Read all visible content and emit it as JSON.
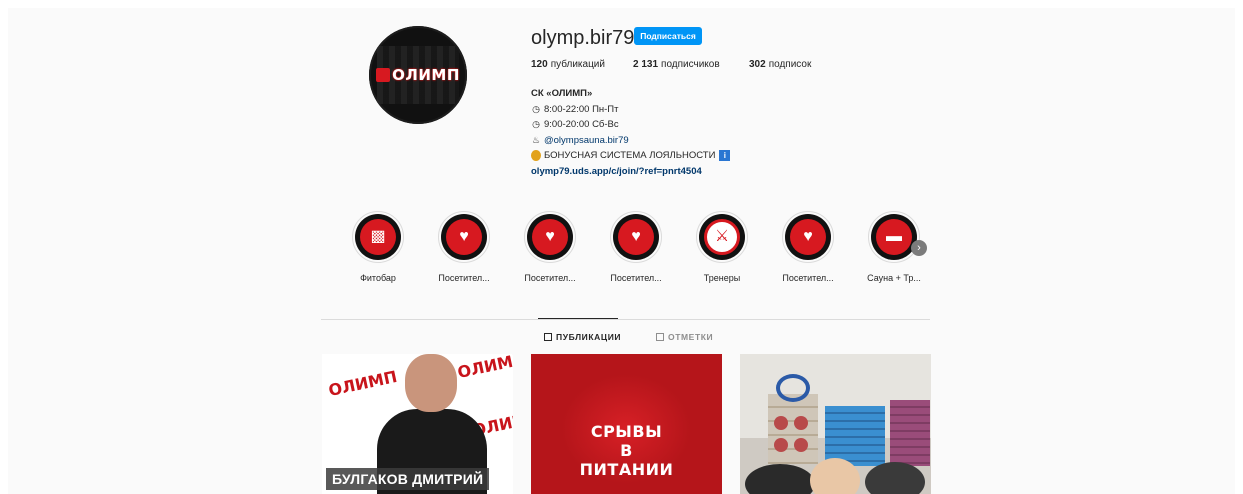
{
  "profile": {
    "avatar_text": "ОЛИМП",
    "username": "olymp.bir79",
    "follow_label": "Подписаться",
    "stats": {
      "posts_count": "120",
      "posts_label": "публикаций",
      "followers_count": "2 131",
      "followers_label": "подписчиков",
      "following_count": "302",
      "following_label": "подписок"
    },
    "bio": {
      "name": "СК «ОЛИМП»",
      "hours1": "8:00-22:00 Пн-Пт",
      "hours2": "9:00-20:00 Сб-Вс",
      "mention": "@olympsauna.bir79",
      "bonus": "БОНУСНАЯ СИСТЕМА ЛОЯЛЬНОСТИ",
      "bonus_badge": "i",
      "link": "olymp79.uds.app/c/join/?ref=pnrt4504"
    }
  },
  "highlights": [
    {
      "label": "Фитобар",
      "icon": "jar-icon"
    },
    {
      "label": "Посетител...",
      "icon": "heart-pulse-icon"
    },
    {
      "label": "Посетител...",
      "icon": "heart-pulse-icon"
    },
    {
      "label": "Посетител...",
      "icon": "heart-pulse-icon"
    },
    {
      "label": "Тренеры",
      "icon": "trainers-icon"
    },
    {
      "label": "Посетител...",
      "icon": "heart-pulse-icon"
    },
    {
      "label": "Сауна + Тр...",
      "icon": "dumbbell-icon"
    }
  ],
  "tabs": {
    "publications": "ПУБЛИКАЦИИ",
    "tagged": "ОТМЕТКИ"
  },
  "posts": {
    "post1_logo": "ОЛИМП",
    "post1_caption": "БУЛГАКОВ ДМИТРИЙ",
    "post2_line1": "СРЫВЫ",
    "post2_line2": "В",
    "post2_line3": "ПИТАНИИ"
  },
  "colors": {
    "accent": "#0095f6",
    "brand_red": "#d71920",
    "link": "#00376b"
  }
}
